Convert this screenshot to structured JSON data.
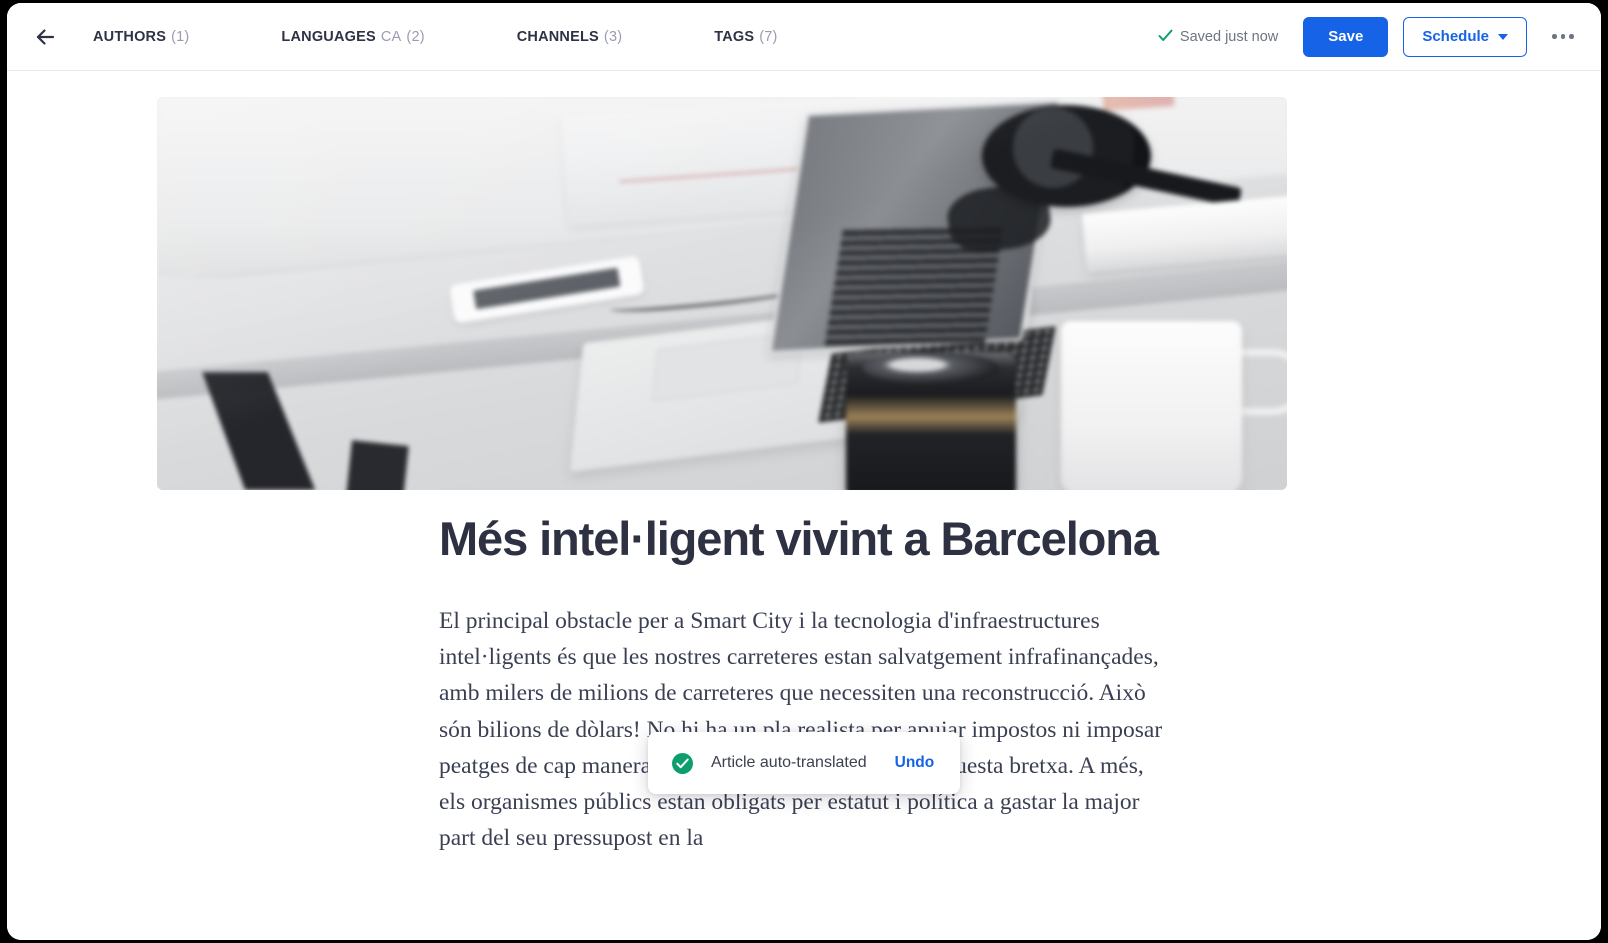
{
  "header": {
    "back_icon": "arrow-left-icon",
    "tabs": [
      {
        "label": "AUTHORS",
        "sub": "",
        "count": "(1)"
      },
      {
        "label": "LANGUAGES",
        "sub": "CA",
        "count": "(2)"
      },
      {
        "label": "CHANNELS",
        "sub": "",
        "count": "(3)"
      },
      {
        "label": "TAGS",
        "sub": "",
        "count": "(7)"
      }
    ],
    "saved_status": "Saved just now",
    "saved_check_icon": "check-icon",
    "save_label": "Save",
    "schedule_label": "Schedule",
    "schedule_caret_icon": "chevron-down-icon",
    "more_icon": "ellipsis-icon"
  },
  "article": {
    "hero_image_alt": "Laptop, headphones, camera lens and mug on a white desk",
    "title": "Més intel·ligent vivint a Barcelona",
    "body": "El principal obstacle per a Smart City i la tecnologia d'infraestructures intel·ligents és que les nostres carreteres estan salvatgement infrafinançades, amb milers de milions de carreteres que necessiten una reconstrucció. Això són bilions de dòlars! No hi ha un pla realista per apujar impostos ni imposar peatges de cap manera que sigui suficient per salvar aquesta bretxa. A més, els organismes públics estan obligats per estatut i política a gastar la major part del seu pressupost en la"
  },
  "toast": {
    "icon": "check-circle-icon",
    "message": "Article auto-translated",
    "undo_label": "Undo"
  },
  "colors": {
    "accent_blue": "#1663e8",
    "success_green": "#0e9e6e",
    "text_dark": "#2d3142",
    "text_muted": "#9a9db0"
  }
}
